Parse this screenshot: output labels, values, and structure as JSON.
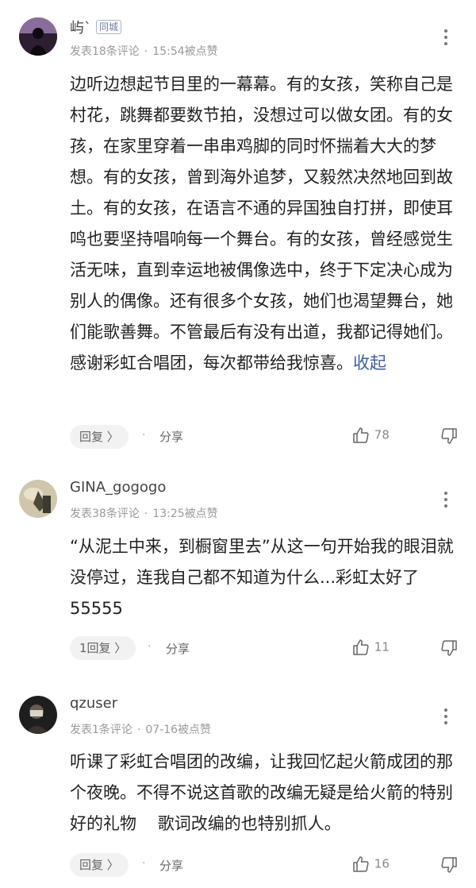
{
  "comments": [
    {
      "username": "屿`",
      "tag": "同城",
      "posted": "发表18条评论",
      "time": "15:54被点赞",
      "text": "边听边想起节目里的一幕幕。有的女孩，笑称自己是村花，跳舞都要数节拍，没想过可以做女团。有的女孩，在家里穿着一串串鸡脚的同时怀揣着大大的梦想。有的女孩，曾到海外追梦，又毅然决然地回到故土。有的女孩，在语言不通的异国独自打拼，即使耳鸣也要坚持唱响每一个舞台。有的女孩，曾经感觉生活无味，直到幸运地被偶像选中，终于下定决心成为别人的偶像。还有很多个女孩，她们也渴望舞台，她们能歌善舞。不管最后有没有出道，我都记得她们。感谢彩虹合唱团，每次都带给我惊喜。",
      "collapse": "收起",
      "reply": "回复 〉",
      "share": "分享",
      "likes": "78"
    },
    {
      "username": "GINA_gogogo",
      "posted": "发表38条评论",
      "time": "13:25被点赞",
      "text": "“从泥土中来，到橱窗里去”从这一句开始我的眼泪就没停过，连我自己都不知道为什么...彩虹太好了55555",
      "reply": "1回复 〉",
      "share": "分享",
      "likes": "11"
    },
    {
      "username": "qzuser",
      "posted": "发表1条评论",
      "time": "07-16被点赞",
      "text": "听课了彩虹合唱团的改编，让我回忆起火箭成团的那个夜晚。不得不说这首歌的改编无疑是给火箭的特别好的礼物    歌词改编的也特别抓人。",
      "reply": "回复 〉",
      "share": "分享",
      "likes": "16"
    }
  ],
  "icons": {
    "more": "more-vertical-icon",
    "like": "thumbs-up-icon",
    "dislike": "thumbs-down-icon"
  },
  "colors": {
    "link": "#3d5f9c",
    "meta": "#9a9a9a",
    "tag": "#6f7ba0"
  }
}
